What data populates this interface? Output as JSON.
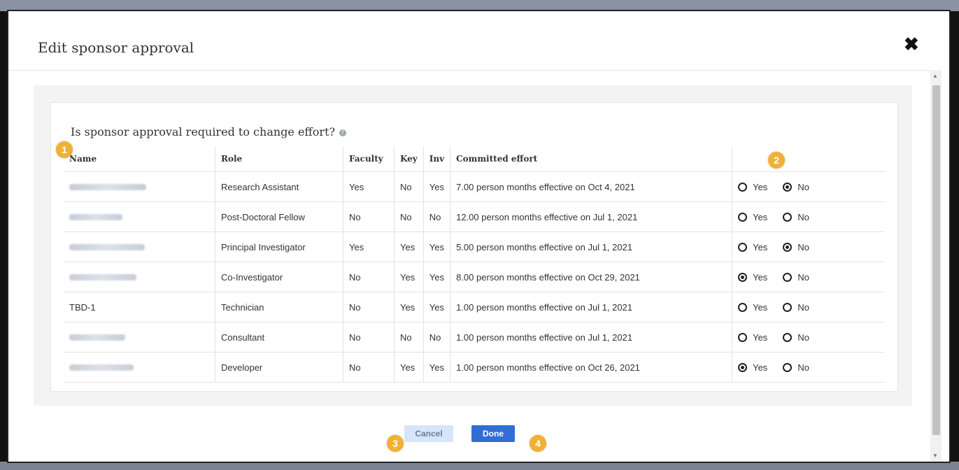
{
  "modal": {
    "title": "Edit sponsor approval",
    "close_symbol": "✖"
  },
  "question": "Is sponsor approval required to change effort?",
  "columns": {
    "name": "Name",
    "role": "Role",
    "faculty": "Faculty",
    "key": "Key",
    "inv": "Inv",
    "effort": "Committed effort"
  },
  "rows": [
    {
      "name": "",
      "role": "Research Assistant",
      "faculty": "Yes",
      "key": "No",
      "inv": "Yes",
      "effort": "7.00 person months effective on Oct 4, 2021",
      "selected": "No"
    },
    {
      "name": "",
      "role": "Post-Doctoral Fellow",
      "faculty": "No",
      "key": "No",
      "inv": "No",
      "effort": "12.00 person months effective on Jul 1, 2021",
      "selected": "none"
    },
    {
      "name": "",
      "role": "Principal Investigator",
      "faculty": "Yes",
      "key": "Yes",
      "inv": "Yes",
      "effort": "5.00 person months effective on Jul 1, 2021",
      "selected": "No"
    },
    {
      "name": "",
      "role": "Co-Investigator",
      "faculty": "No",
      "key": "Yes",
      "inv": "Yes",
      "effort": "8.00 person months effective on Oct 29, 2021",
      "selected": "Yes"
    },
    {
      "name": "TBD-1",
      "role": "Technician",
      "faculty": "No",
      "key": "Yes",
      "inv": "Yes",
      "effort": "1.00 person months effective on Jul 1, 2021",
      "selected": "none"
    },
    {
      "name": "",
      "role": "Consultant",
      "faculty": "No",
      "key": "No",
      "inv": "No",
      "effort": "1.00 person months effective on Jul 1, 2021",
      "selected": "none"
    },
    {
      "name": "",
      "role": "Developer",
      "faculty": "No",
      "key": "Yes",
      "inv": "Yes",
      "effort": "1.00 person months effective on Oct 26, 2021",
      "selected": "Yes"
    }
  ],
  "radio_labels": {
    "yes": "Yes",
    "no": "No"
  },
  "badges": [
    "1",
    "2",
    "3",
    "4"
  ],
  "buttons": {
    "cancel": "Cancel",
    "done": "Done"
  },
  "colors": {
    "accent": "#2f6fd3",
    "badge": "#f2b134",
    "cancel_bg": "#d6e6f8"
  }
}
